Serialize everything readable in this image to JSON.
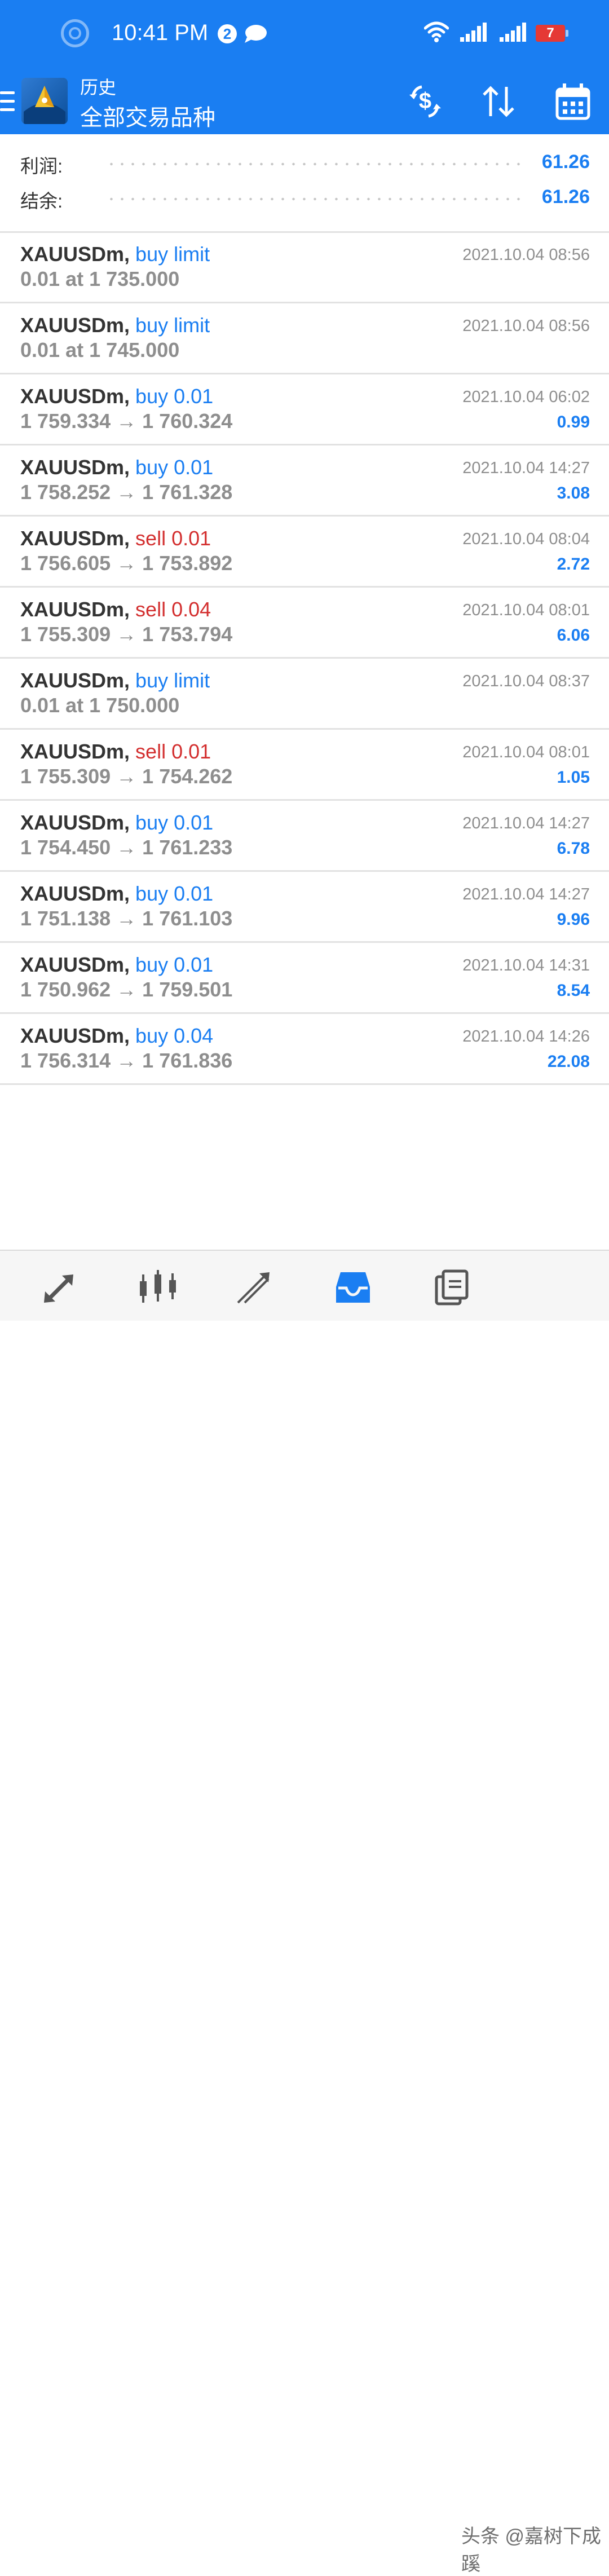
{
  "status_bar": {
    "time": "10:41 PM",
    "notification_count": "2",
    "battery_level": "7"
  },
  "header": {
    "subtitle": "历史",
    "title": "全部交易品种",
    "color": "#1a7ef2"
  },
  "summary": {
    "profit_label": "利润:",
    "profit_value": "61.26",
    "balance_label": "结余:",
    "balance_value": "61.26"
  },
  "deals": [
    {
      "symbol": "XAUUSDm,",
      "side": "buy",
      "type": "buy limit",
      "prices": "0.01 at 1 735.000",
      "open": "",
      "close": "",
      "time": "2021.10.04 08:56",
      "profit": ""
    },
    {
      "symbol": "XAUUSDm,",
      "side": "buy",
      "type": "buy limit",
      "prices": "0.01 at 1 745.000",
      "open": "",
      "close": "",
      "time": "2021.10.04 08:56",
      "profit": ""
    },
    {
      "symbol": "XAUUSDm,",
      "side": "buy",
      "type": "buy 0.01",
      "prices": "",
      "open": "1 759.334",
      "close": "1 760.324",
      "time": "2021.10.04 06:02",
      "profit": "0.99"
    },
    {
      "symbol": "XAUUSDm,",
      "side": "buy",
      "type": "buy 0.01",
      "prices": "",
      "open": "1 758.252",
      "close": "1 761.328",
      "time": "2021.10.04 14:27",
      "profit": "3.08"
    },
    {
      "symbol": "XAUUSDm,",
      "side": "sell",
      "type": "sell 0.01",
      "prices": "",
      "open": "1 756.605",
      "close": "1 753.892",
      "time": "2021.10.04 08:04",
      "profit": "2.72"
    },
    {
      "symbol": "XAUUSDm,",
      "side": "sell",
      "type": "sell 0.04",
      "prices": "",
      "open": "1 755.309",
      "close": "1 753.794",
      "time": "2021.10.04 08:01",
      "profit": "6.06"
    },
    {
      "symbol": "XAUUSDm,",
      "side": "buy",
      "type": "buy limit",
      "prices": "0.01 at 1 750.000",
      "open": "",
      "close": "",
      "time": "2021.10.04 08:37",
      "profit": ""
    },
    {
      "symbol": "XAUUSDm,",
      "side": "sell",
      "type": "sell 0.01",
      "prices": "",
      "open": "1 755.309",
      "close": "1 754.262",
      "time": "2021.10.04 08:01",
      "profit": "1.05"
    },
    {
      "symbol": "XAUUSDm,",
      "side": "buy",
      "type": "buy 0.01",
      "prices": "",
      "open": "1 754.450",
      "close": "1 761.233",
      "time": "2021.10.04 14:27",
      "profit": "6.78"
    },
    {
      "symbol": "XAUUSDm,",
      "side": "buy",
      "type": "buy 0.01",
      "prices": "",
      "open": "1 751.138",
      "close": "1 761.103",
      "time": "2021.10.04 14:27",
      "profit": "9.96"
    },
    {
      "symbol": "XAUUSDm,",
      "side": "buy",
      "type": "buy 0.01",
      "prices": "",
      "open": "1 750.962",
      "close": "1 759.501",
      "time": "2021.10.04 14:31",
      "profit": "8.54"
    },
    {
      "symbol": "XAUUSDm,",
      "side": "buy",
      "type": "buy 0.04",
      "prices": "",
      "open": "1 756.314",
      "close": "1 761.836",
      "time": "2021.10.04 14:26",
      "profit": "22.08"
    }
  ],
  "colors": {
    "buy": "#1a7ef2",
    "sell": "#d32f2f",
    "muted": "#8e8e8e"
  },
  "bottom_nav": {
    "items": [
      "quotes-icon",
      "chart-icon",
      "trade-icon",
      "history-icon",
      "messages-icon"
    ],
    "active": "history-icon"
  },
  "watermark": "头条 @嘉树下成蹊"
}
